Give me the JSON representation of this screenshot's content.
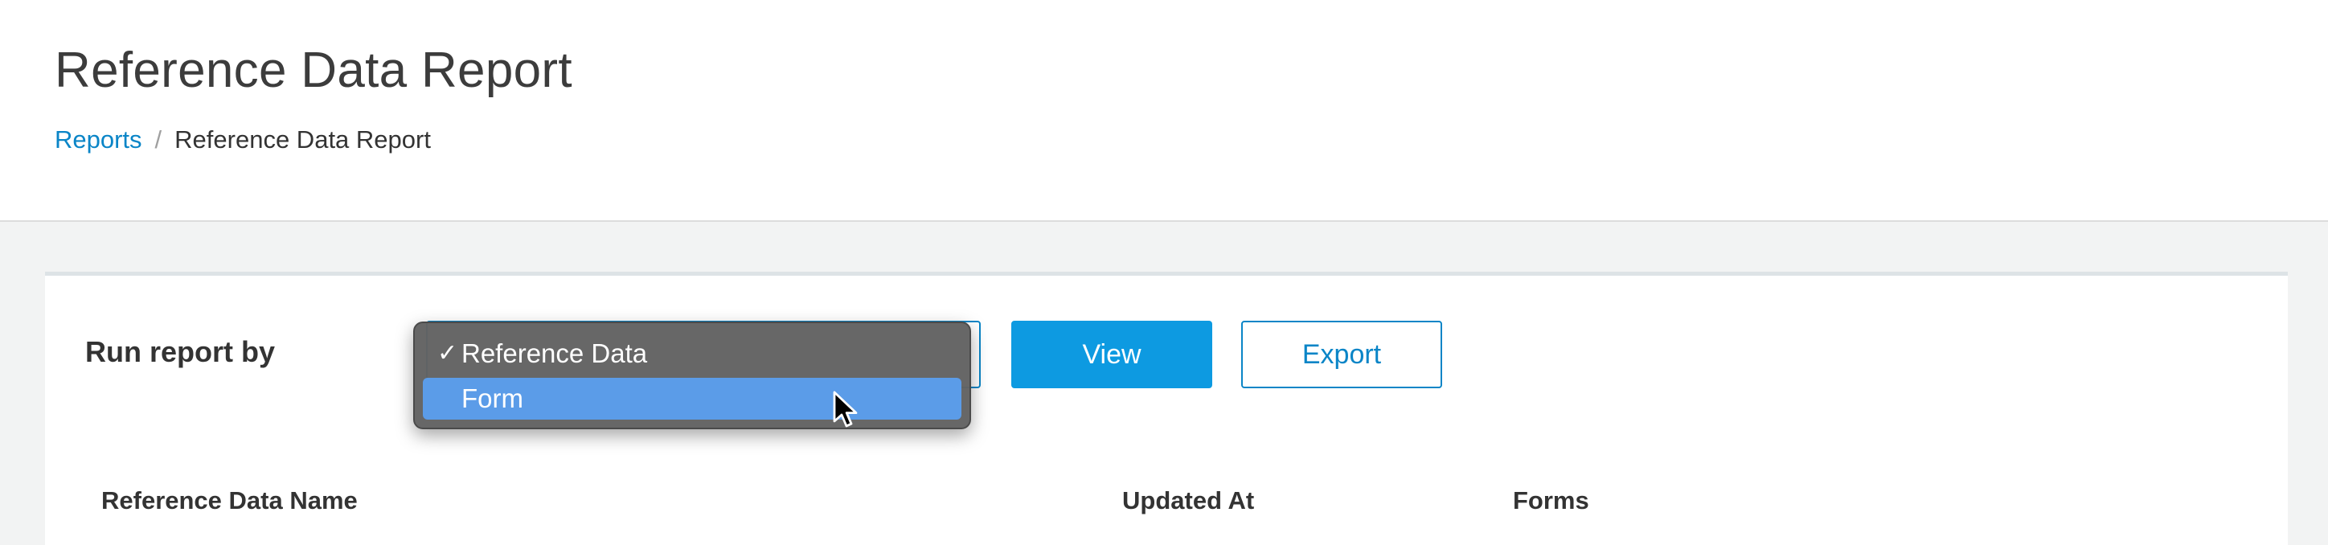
{
  "header": {
    "title": "Reference Data Report",
    "breadcrumb": {
      "link": "Reports",
      "separator": "/",
      "current": "Reference Data Report"
    }
  },
  "panel": {
    "run_label": "Run report by",
    "select": {
      "selected_value": "Reference Data",
      "options": [
        {
          "label": "Reference Data",
          "checked": true,
          "highlighted": false
        },
        {
          "label": "Form",
          "checked": false,
          "highlighted": true
        }
      ]
    },
    "buttons": {
      "view": "View",
      "export": "Export"
    },
    "table": {
      "columns": [
        "Reference Data Name",
        "Updated At",
        "Forms"
      ]
    }
  },
  "colors": {
    "accent": "#0a85c7",
    "primary_button": "#0d9ae1",
    "menu_background": "#626262",
    "menu_highlight": "#5b9ce8"
  },
  "icons": {
    "check": "checkmark-icon",
    "cursor": "mouse-pointer-icon"
  }
}
